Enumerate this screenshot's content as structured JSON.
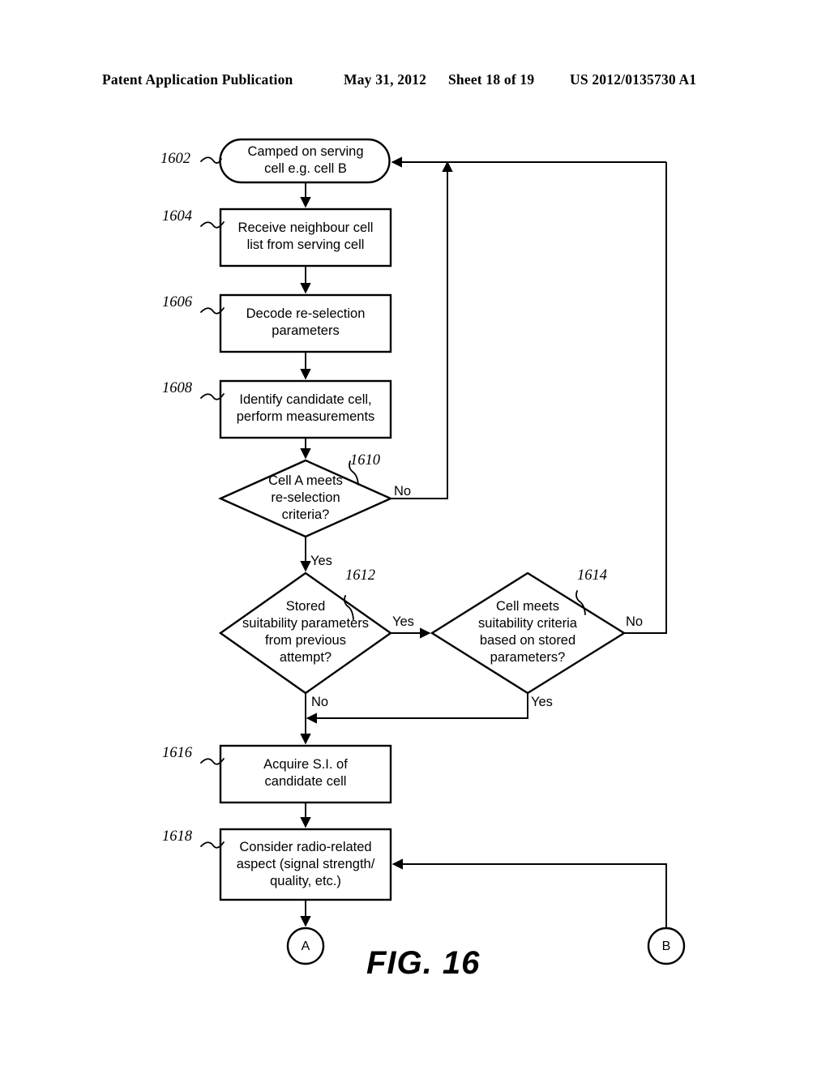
{
  "header": {
    "publication": "Patent Application Publication",
    "date": "May 31, 2012",
    "sheet": "Sheet 18 of 19",
    "number": "US 2012/0135730 A1"
  },
  "figure": {
    "caption": "FIG. 16"
  },
  "nodes": {
    "n1602": {
      "ref": "1602",
      "shape": "terminator",
      "text": "Camped on serving\ncell e.g. cell B"
    },
    "n1604": {
      "ref": "1604",
      "shape": "process",
      "text": "Receive neighbour cell\nlist from serving cell"
    },
    "n1606": {
      "ref": "1606",
      "shape": "process",
      "text": "Decode re-selection\nparameters"
    },
    "n1608": {
      "ref": "1608",
      "shape": "process",
      "text": "Identify candidate cell,\nperform measurements"
    },
    "n1610": {
      "ref": "1610",
      "shape": "decision",
      "text": "Cell A meets\nre-selection\ncriteria?"
    },
    "n1612": {
      "ref": "1612",
      "shape": "decision",
      "text": "Stored\nsuitability parameters\nfrom previous\nattempt?"
    },
    "n1614": {
      "ref": "1614",
      "shape": "decision",
      "text": "Cell meets\nsuitability criteria\nbased on stored\nparameters?"
    },
    "n1616": {
      "ref": "1616",
      "shape": "process",
      "text": "Acquire S.I. of\ncandidate cell"
    },
    "n1618": {
      "ref": "1618",
      "shape": "process",
      "text": "Consider radio-related\naspect (signal strength/\nquality, etc.)"
    },
    "connA": {
      "shape": "connector",
      "text": "A"
    },
    "connB": {
      "shape": "connector",
      "text": "B"
    }
  },
  "edges": {
    "e1610_no": "No",
    "e1610_yes": "Yes",
    "e1612_yes": "Yes",
    "e1612_no": "No",
    "e1614_no": "No",
    "e1614_yes": "Yes"
  },
  "colors": {
    "ink": "#000000",
    "paper": "#ffffff"
  }
}
